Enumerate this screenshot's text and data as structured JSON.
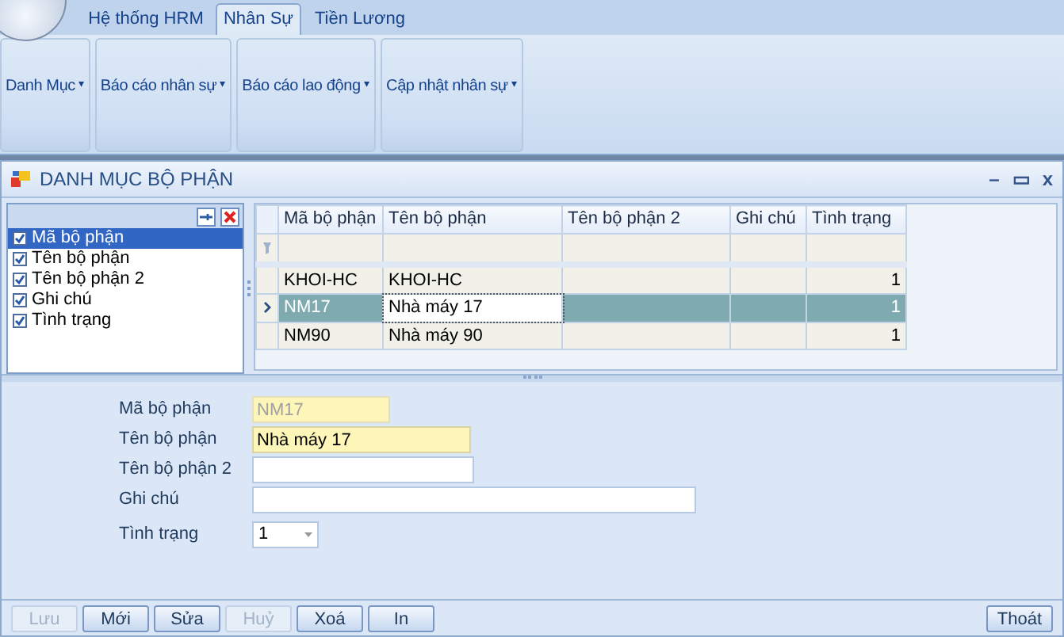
{
  "ribbon": {
    "tabs": [
      {
        "label": "Hệ thống HRM",
        "selected": false
      },
      {
        "label": "Nhân Sự",
        "selected": true
      },
      {
        "label": "Tiền Lương",
        "selected": false
      }
    ],
    "groups": [
      {
        "label": "Danh Mục",
        "caret": "▾"
      },
      {
        "label": "Báo cáo nhân sự",
        "caret": "▾"
      },
      {
        "label": "Báo cáo lao động",
        "caret": "▾"
      },
      {
        "label": "Cập nhật nhân sự",
        "caret": "▾"
      }
    ]
  },
  "window": {
    "title": "DANH MỤC BỘ PHẬN",
    "controls": [
      "–",
      "▭",
      "x"
    ]
  },
  "column_chooser": {
    "items": [
      {
        "label": "Mã bộ phận",
        "checked": true,
        "selected": true
      },
      {
        "label": "Tên bộ phận",
        "checked": true,
        "selected": false
      },
      {
        "label": "Tên bộ phận 2",
        "checked": true,
        "selected": false
      },
      {
        "label": "Ghi chú",
        "checked": true,
        "selected": false
      },
      {
        "label": "Tình trạng",
        "checked": true,
        "selected": false
      }
    ]
  },
  "table": {
    "columns": [
      "Mã bộ phận",
      "Tên bộ phận",
      "Tên bộ phận 2",
      "Ghi chú",
      "Tình trạng"
    ],
    "rows": [
      {
        "cells": [
          "KHOI-HC",
          "KHOI-HC",
          "",
          "",
          "1"
        ],
        "selected": false
      },
      {
        "cells": [
          "NM17",
          "Nhà máy 17",
          "",
          "",
          "1"
        ],
        "selected": true
      },
      {
        "cells": [
          "NM90",
          "Nhà máy 90",
          "",
          "",
          "1"
        ],
        "selected": false
      }
    ]
  },
  "form": [
    {
      "label": "Mã bộ phận",
      "value": "NM17",
      "kind": "text",
      "required": true,
      "disabled": true
    },
    {
      "label": "Tên bộ phận",
      "value": "Nhà máy 17",
      "kind": "text",
      "required": true,
      "disabled": false
    },
    {
      "label": "Tên bộ phận 2",
      "kind": "text",
      "required": false,
      "disabled": false
    },
    {
      "label": "Ghi chú",
      "kind": "text",
      "required": false,
      "disabled": false
    },
    {
      "label": "Tình trạng",
      "value": "1",
      "kind": "dropdown",
      "required": false,
      "disabled": false
    }
  ],
  "buttons": [
    {
      "label": "Lưu",
      "disabled": true
    },
    {
      "label": "Mới",
      "disabled": false
    },
    {
      "label": "Sửa",
      "disabled": false
    },
    {
      "label": "Huỷ",
      "disabled": true
    },
    {
      "label": "Xoá",
      "disabled": false
    },
    {
      "label": "In",
      "disabled": false
    }
  ],
  "exit_button": {
    "label": "Thoát"
  }
}
